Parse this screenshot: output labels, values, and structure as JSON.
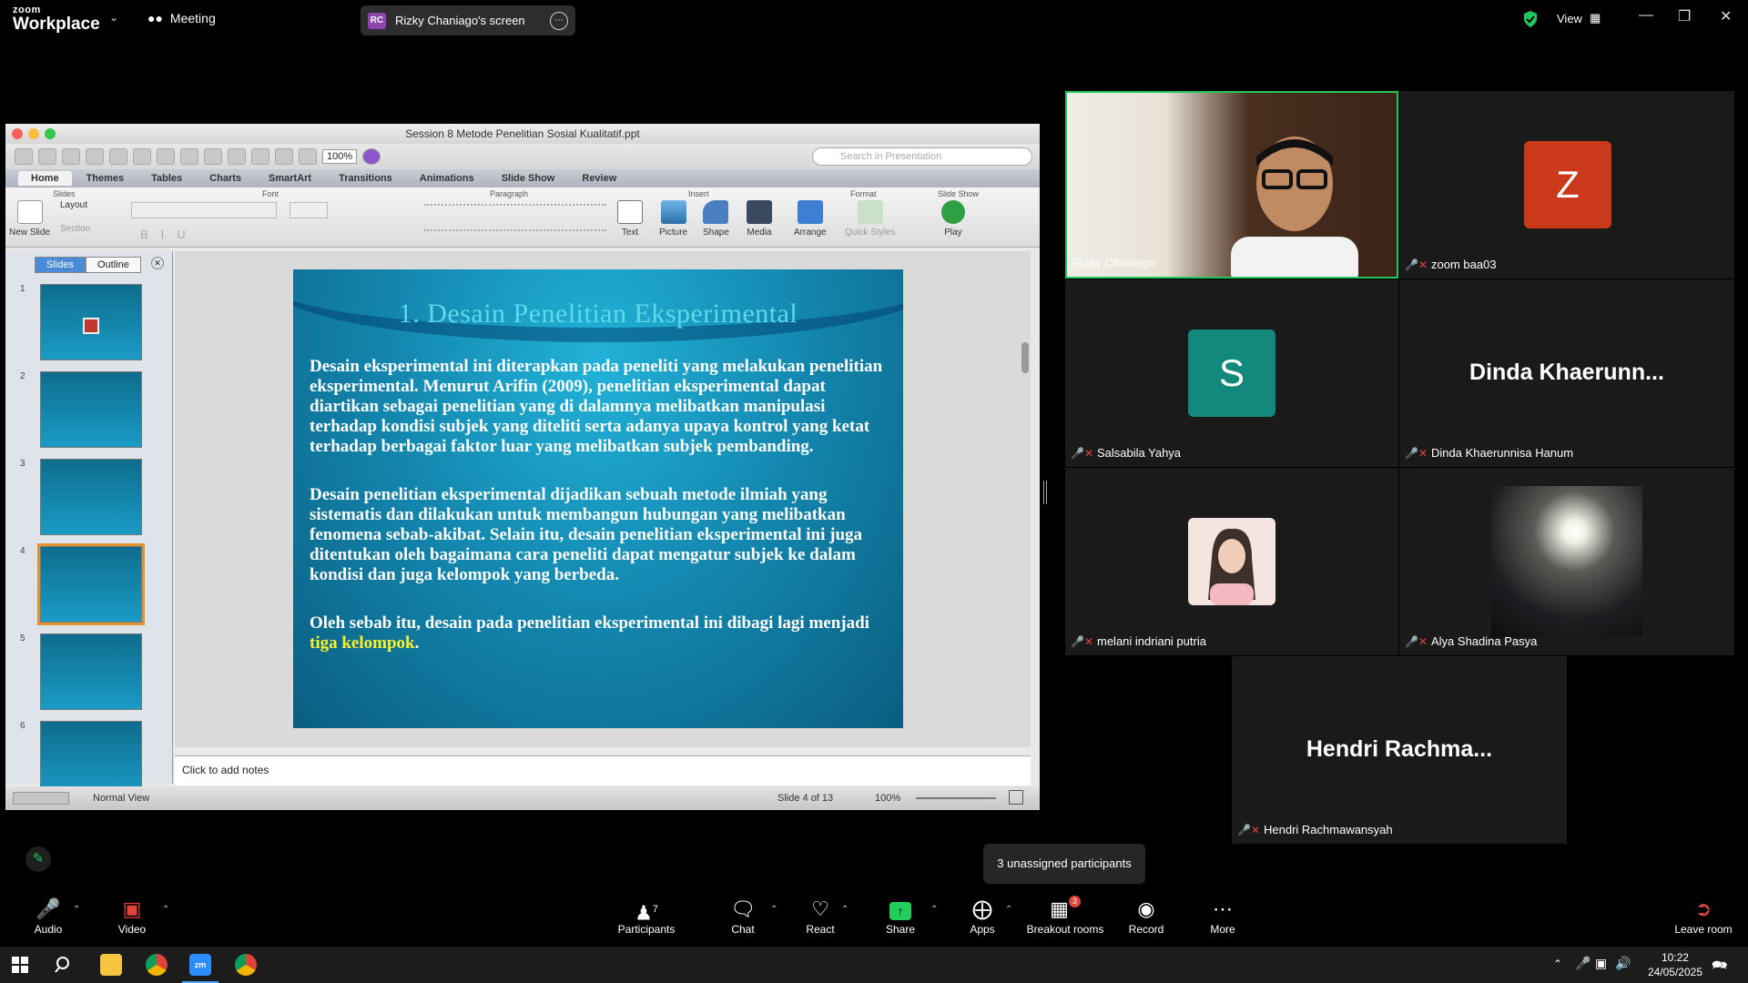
{
  "zoom": {
    "logo_small": "zoom",
    "logo_big": "Workplace",
    "meeting_label": "Meeting",
    "share_initials": "RC",
    "share_title": "Rizky Chaniago's screen",
    "view_label": "View"
  },
  "ppt": {
    "window_title": "Session 8 Metode Penelitian Sosial Kualitatif.ppt",
    "zoom_field": "100%",
    "search_placeholder": "Search in Presentation",
    "tabs": [
      "Home",
      "Themes",
      "Tables",
      "Charts",
      "SmartArt",
      "Transitions",
      "Animations",
      "Slide Show",
      "Review"
    ],
    "groups": {
      "slides": "Slides",
      "font": "Font",
      "paragraph": "Paragraph",
      "insert": "Insert",
      "format": "Format",
      "slideshow": "Slide Show"
    },
    "buttons": {
      "new_slide": "New Slide",
      "layout": "Layout",
      "section": "Section",
      "text": "Text",
      "picture": "Picture",
      "shape": "Shape",
      "media": "Media",
      "arrange": "Arrange",
      "quick_styles": "Quick Styles",
      "play": "Play"
    },
    "panel_tabs": {
      "slides": "Slides",
      "outline": "Outline"
    },
    "slide_numbers": [
      "1",
      "2",
      "3",
      "4",
      "5",
      "6"
    ],
    "slide": {
      "title": "1. Desain Penelitian Eksperimental",
      "para1": "Desain eksperimental ini diterapkan pada peneliti yang melakukan penelitian eksperimental. Menurut Arifin (2009), penelitian eksperimental dapat diartikan sebagai penelitian yang di dalamnya melibatkan manipulasi terhadap kondisi subjek yang diteliti serta adanya upaya kontrol yang ketat terhadap berbagai faktor luar yang melibatkan subjek pembanding.",
      "para2": "Desain penelitian eksperimental dijadikan sebuah metode ilmiah yang sistematis dan dilakukan untuk membangun hubungan yang melibatkan fenomena sebab-akibat. Selain itu, desain penelitian eksperimental ini juga ditentukan oleh bagaimana cara peneliti dapat mengatur subjek ke dalam kondisi dan juga kelompok yang berbeda.",
      "para3_pre": "Oleh sebab itu, desain pada penelitian eksperimental ini dibagi lagi menjadi ",
      "para3_hl": "tiga kelompok",
      "para3_post": "."
    },
    "notes_placeholder": "Click to add notes",
    "status_view": "Normal View",
    "status_slide": "Slide 4 of 13",
    "status_zoom": "100%"
  },
  "participants": {
    "p1": "Rizky Chaniago",
    "p2_initial": "Z",
    "p2": "zoom baa03",
    "p3_initial": "S",
    "p3": "Salsabila Yahya",
    "p4_big": "Dinda  Khaerunn...",
    "p4": "Dinda Khaerunnisa Hanum",
    "p5": "melani indriani putria",
    "p6": "Alya Shadina Pasya",
    "p7_big": "Hendri  Rachma...",
    "p7": "Hendri Rachmawansyah"
  },
  "tooltip": "3 unassigned participants",
  "controls": {
    "audio": "Audio",
    "video": "Video",
    "participants": "Participants",
    "participants_count": "7",
    "chat": "Chat",
    "react": "React",
    "share": "Share",
    "apps": "Apps",
    "breakout": "Breakout rooms",
    "breakout_badge": "3",
    "record": "Record",
    "more": "More",
    "leave": "Leave room"
  },
  "clock": {
    "time": "10:22",
    "date": "24/05/2025"
  },
  "colors": {
    "accent_green": "#22c55e",
    "share_green": "#1fce5b",
    "zoom_red": "#e0443a",
    "z_avatar": "#c9391a",
    "s_avatar": "#12897b"
  }
}
